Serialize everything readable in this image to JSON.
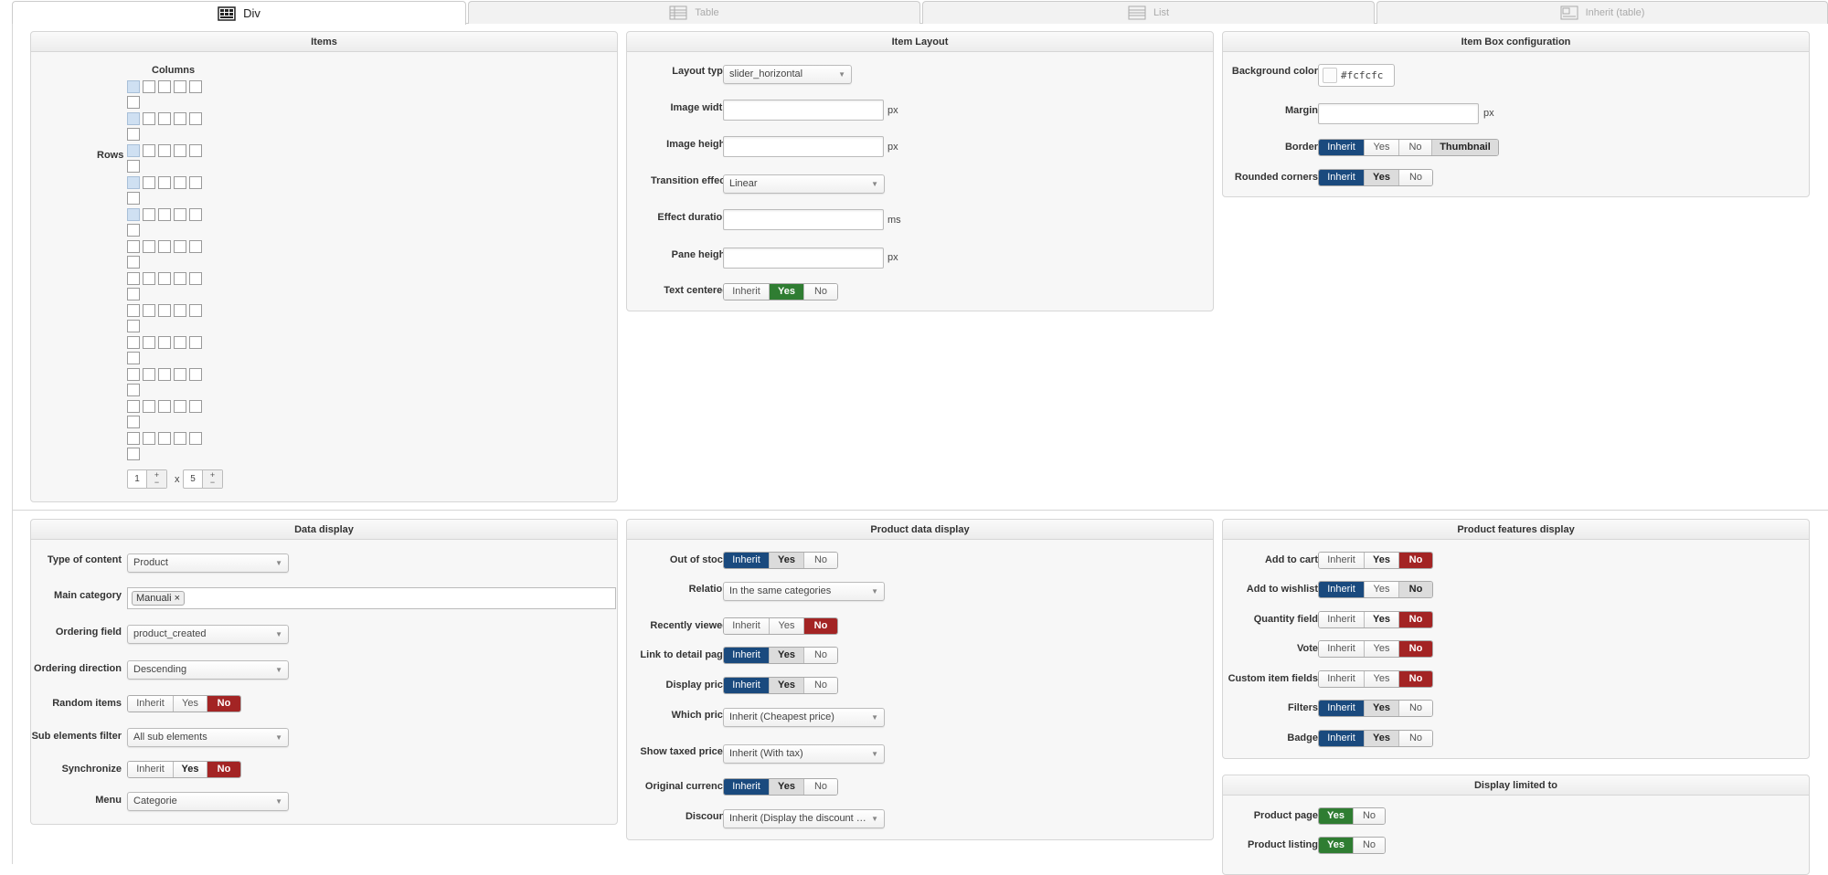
{
  "tabs": [
    {
      "label": "Div",
      "icon": "grid-div-icon"
    },
    {
      "label": "Table",
      "icon": "table-icon"
    },
    {
      "label": "List",
      "icon": "list-icon"
    },
    {
      "label": "Inherit (table)",
      "icon": "inherit-table-icon"
    }
  ],
  "items_panel": {
    "title": "Items",
    "columns_label": "Columns",
    "rows_label": "Rows",
    "grid": {
      "rows": 12,
      "cols": 5,
      "selected_rows": 5,
      "selected_cols": 1
    },
    "rows_value": "1",
    "times": "x",
    "cols_value": "5",
    "plus": "+",
    "minus": "−"
  },
  "item_layout": {
    "title": "Item Layout",
    "layout_type": {
      "label": "Layout type",
      "value": "slider_horizontal"
    },
    "image_width": {
      "label": "Image width",
      "unit": "px"
    },
    "image_height": {
      "label": "Image height",
      "unit": "px"
    },
    "transition_effect": {
      "label": "Transition effect",
      "value": "Linear"
    },
    "effect_duration": {
      "label": "Effect duration",
      "unit": "ms"
    },
    "pane_height": {
      "label": "Pane height",
      "unit": "px"
    },
    "text_centered": {
      "label": "Text centered",
      "options": [
        "Inherit",
        "Yes",
        "No"
      ]
    }
  },
  "item_box": {
    "title": "Item Box configuration",
    "background_color": {
      "label": "Background color",
      "value": "#fcfcfc"
    },
    "margin": {
      "label": "Margin",
      "unit": "px"
    },
    "border": {
      "label": "Border",
      "options": [
        "Inherit",
        "Yes",
        "No",
        "Thumbnail"
      ]
    },
    "rounded_corners": {
      "label": "Rounded corners",
      "options": [
        "Inherit",
        "Yes",
        "No"
      ]
    }
  },
  "data_display": {
    "title": "Data display",
    "type_of_content": {
      "label": "Type of content",
      "value": "Product"
    },
    "main_category": {
      "label": "Main category",
      "tag": "Manuali",
      "remove": "×"
    },
    "ordering_field": {
      "label": "Ordering field",
      "value": "product_created"
    },
    "ordering_direction": {
      "label": "Ordering direction",
      "value": "Descending"
    },
    "random_items": {
      "label": "Random items",
      "options": [
        "Inherit",
        "Yes",
        "No"
      ]
    },
    "sub_elements_filter": {
      "label": "Sub elements filter",
      "value": "All sub elements"
    },
    "synchronize": {
      "label": "Synchronize",
      "options": [
        "Inherit",
        "Yes",
        "No"
      ]
    },
    "menu": {
      "label": "Menu",
      "value": "Categorie"
    }
  },
  "product_data": {
    "title": "Product data display",
    "out_of_stock": {
      "label": "Out of stock",
      "options": [
        "Inherit",
        "Yes",
        "No"
      ]
    },
    "relation": {
      "label": "Relation",
      "value": "In the same categories"
    },
    "recently_viewed": {
      "label": "Recently viewed",
      "options": [
        "Inherit",
        "Yes",
        "No"
      ]
    },
    "link_to_detail": {
      "label": "Link to detail page",
      "options": [
        "Inherit",
        "Yes",
        "No"
      ]
    },
    "display_price": {
      "label": "Display price",
      "options": [
        "Inherit",
        "Yes",
        "No"
      ]
    },
    "which_price": {
      "label": "Which price",
      "value": "Inherit (Cheapest price)"
    },
    "show_taxed": {
      "label": "Show taxed prices",
      "value": "Inherit (With tax)"
    },
    "original_currency": {
      "label": "Original currency",
      "options": [
        "Inherit",
        "Yes",
        "No"
      ]
    },
    "discount": {
      "label": "Discount",
      "value": "Inherit (Display the discount a..."
    }
  },
  "product_features": {
    "title": "Product features display",
    "add_to_cart": {
      "label": "Add to cart",
      "options": [
        "Inherit",
        "Yes",
        "No"
      ]
    },
    "add_to_wishlist": {
      "label": "Add to wishlist",
      "options": [
        "Inherit",
        "Yes",
        "No"
      ]
    },
    "quantity_field": {
      "label": "Quantity field",
      "options": [
        "Inherit",
        "Yes",
        "No"
      ]
    },
    "vote": {
      "label": "Vote",
      "options": [
        "Inherit",
        "Yes",
        "No"
      ]
    },
    "custom_item_fields": {
      "label": "Custom item fields",
      "options": [
        "Inherit",
        "Yes",
        "No"
      ]
    },
    "filters": {
      "label": "Filters",
      "options": [
        "Inherit",
        "Yes",
        "No"
      ]
    },
    "badge": {
      "label": "Badge",
      "options": [
        "Inherit",
        "Yes",
        "No"
      ]
    }
  },
  "display_limited": {
    "title": "Display limited to",
    "product_page": {
      "label": "Product page",
      "options": [
        "Yes",
        "No"
      ]
    },
    "product_listing": {
      "label": "Product listing",
      "options": [
        "Yes",
        "No"
      ]
    }
  },
  "colors": {
    "inherit_blue": "#1a4a7e",
    "yes_green": "#2f7d32",
    "no_red": "#a32424"
  }
}
